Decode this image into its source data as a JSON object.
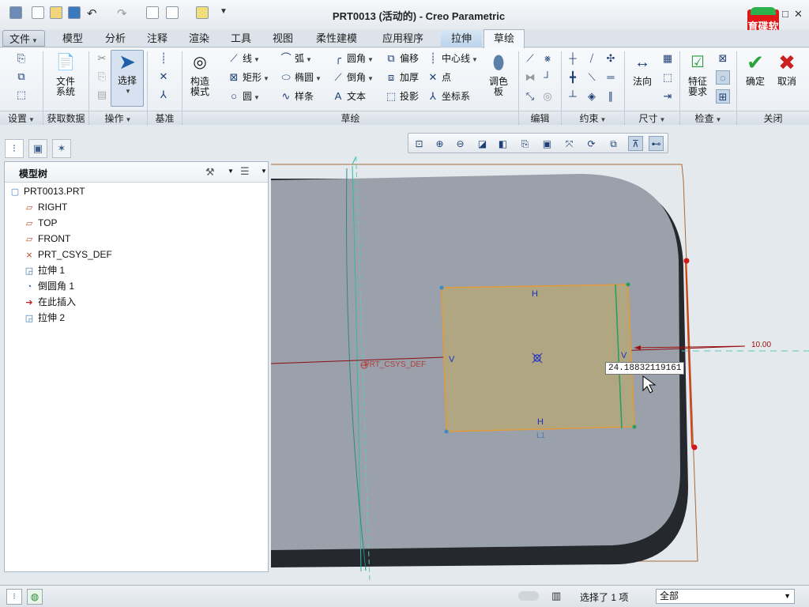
{
  "window": {
    "title": "PRT0013 (活动的) - Creo Parametric",
    "buttons": [
      "–",
      "□",
      "✕"
    ]
  },
  "logo": {
    "text": "育碟软件"
  },
  "tabs": [
    "文件",
    "模型",
    "分析",
    "注释",
    "渲染",
    "工具",
    "视图",
    "柔性建模",
    "应用程序",
    "拉伸",
    "草绘"
  ],
  "ribbon": {
    "groups": [
      "设置",
      "获取数据",
      "操作",
      "基准",
      "草绘",
      "编辑",
      "约束",
      "尺寸",
      "检查",
      "关闭"
    ],
    "file_system": "文件\n系统",
    "select": "选择",
    "construct": "构造\n模式",
    "sketch_tools": {
      "line": "线",
      "arc": "弧",
      "fillet": "圆角",
      "offset": "偏移",
      "centerline": "中心线",
      "rect": "矩形",
      "ellipse": "椭圆",
      "chamfer": "倒角",
      "thicken": "加厚",
      "point": "点",
      "circle": "圆",
      "spline": "样条",
      "text": "文本",
      "project": "投影",
      "csys": "坐标系"
    },
    "palette": "调色\n板",
    "normal": "法向",
    "feature_req": "特征\n要求",
    "ok": "确定",
    "cancel": "取消"
  },
  "model_tree": {
    "header": "模型树",
    "items": [
      {
        "label": "PRT0013.PRT",
        "icon": "part-icon"
      },
      {
        "label": "RIGHT",
        "icon": "datum-plane-icon"
      },
      {
        "label": "TOP",
        "icon": "datum-plane-icon"
      },
      {
        "label": "FRONT",
        "icon": "datum-plane-icon"
      },
      {
        "label": "PRT_CSYS_DEF",
        "icon": "csys-icon"
      },
      {
        "label": "拉伸 1",
        "icon": "extrude-icon"
      },
      {
        "label": "倒圆角 1",
        "icon": "round-icon"
      },
      {
        "label": "在此插入",
        "icon": "insert-arrow-icon"
      },
      {
        "label": "拉伸 2",
        "icon": "extrude-icon"
      }
    ]
  },
  "canvas": {
    "csys_label": "PRT_CSYS_DEF",
    "dimension_input": "24.18832119161",
    "dimension_value": "10.00",
    "constraint_labels": {
      "h_top": "H",
      "h_bottom": "H",
      "v_left": "V",
      "v_right": "V",
      "l1": "L1"
    }
  },
  "status": {
    "selected": "选择了 1 项",
    "filter": "全部"
  },
  "colors": {
    "part": "#9aa1ab",
    "part_edge": "#2f3338",
    "sketch_fill": "#b1a682",
    "sketch_edge": "#e39a3a",
    "constraint": "#1d2ec2",
    "dimension": "#b01010",
    "cyan": "#35b8a8"
  }
}
